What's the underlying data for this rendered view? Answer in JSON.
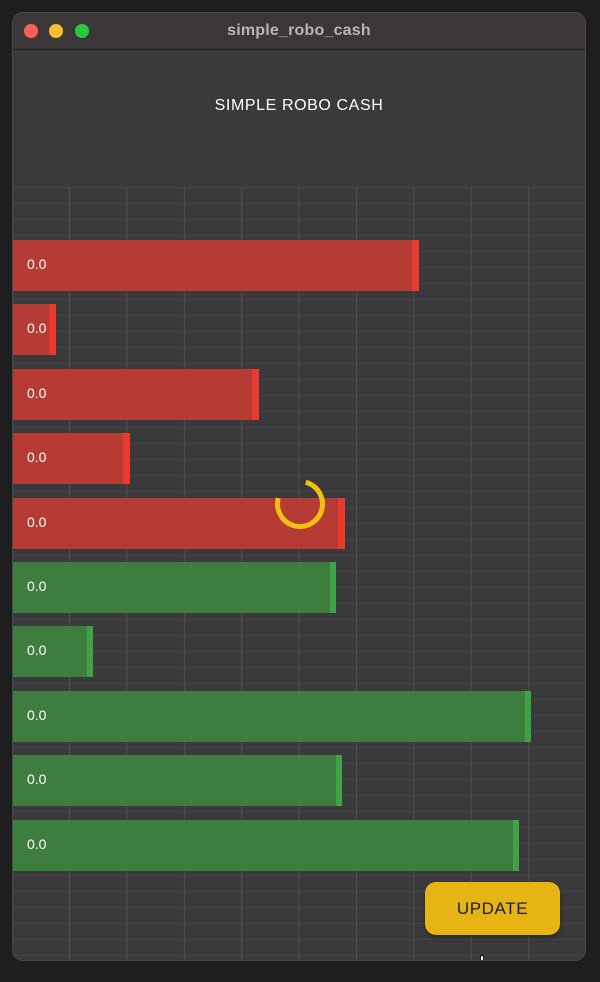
{
  "window": {
    "title": "simple_robo_cash"
  },
  "app": {
    "title": "SIMPLE ROBO CASH"
  },
  "colors": {
    "negative_bar": "#b73b35",
    "negative_edge": "#ea3a30",
    "positive_bar": "#3d7e3f",
    "positive_edge": "#3fa244",
    "spinner": "#f1c010",
    "button": "#e6b513"
  },
  "bars": [
    {
      "label": "0.0",
      "status": "red",
      "level": 0.71
    },
    {
      "label": "0.0",
      "status": "red",
      "level": 0.075
    },
    {
      "label": "0.0",
      "status": "red",
      "level": 0.43
    },
    {
      "label": "0.0",
      "status": "red",
      "level": 0.205
    },
    {
      "label": "0.0",
      "status": "red",
      "level": 0.58
    },
    {
      "label": "0.0",
      "status": "green",
      "level": 0.565
    },
    {
      "label": "0.0",
      "status": "green",
      "level": 0.14
    },
    {
      "label": "0.0",
      "status": "green",
      "level": 0.905
    },
    {
      "label": "0.0",
      "status": "green",
      "level": 0.575
    },
    {
      "label": "0.0",
      "status": "green",
      "level": 0.885
    }
  ],
  "actions": {
    "update_label": "UPDATE"
  },
  "loading": true
}
